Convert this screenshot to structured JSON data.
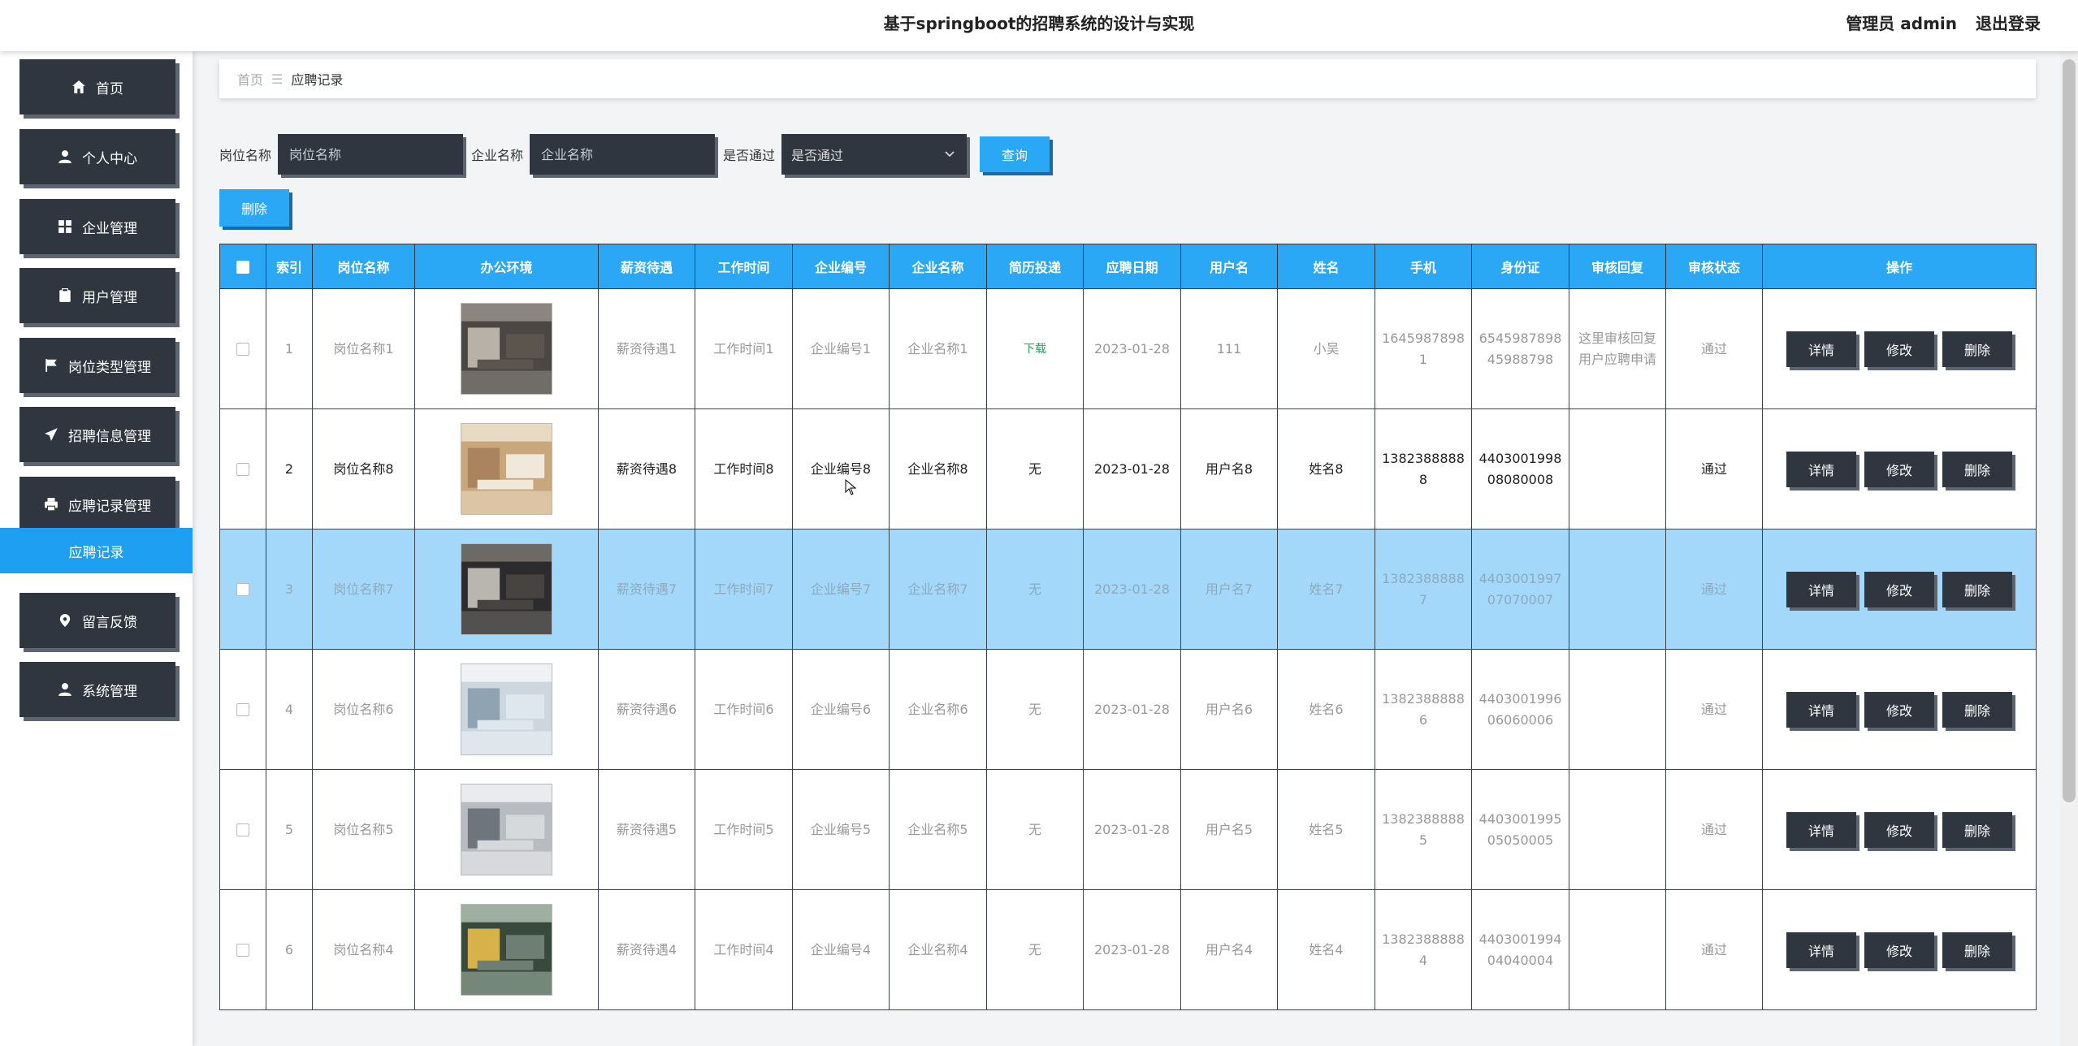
{
  "header": {
    "title": "基于springboot的招聘系统的设计与实现",
    "user": "管理员 admin",
    "logout": "退出登录"
  },
  "sidebar": {
    "items": [
      {
        "label": "首页",
        "icon": "home-icon"
      },
      {
        "label": "个人中心",
        "icon": "user-icon"
      },
      {
        "label": "企业管理",
        "icon": "grid-icon"
      },
      {
        "label": "用户管理",
        "icon": "clipboard-icon"
      },
      {
        "label": "岗位类型管理",
        "icon": "flag-icon"
      },
      {
        "label": "招聘信息管理",
        "icon": "send-icon"
      },
      {
        "label": "应聘记录管理",
        "icon": "print-icon"
      },
      {
        "label": "留言反馈",
        "icon": "map-pin-icon"
      },
      {
        "label": "系统管理",
        "icon": "user-icon"
      }
    ],
    "active_sub": "应聘记录"
  },
  "breadcrumb": {
    "home": "首页",
    "sep": "☰",
    "current": "应聘记录"
  },
  "filters": {
    "job_label": "岗位名称",
    "job_placeholder": "岗位名称",
    "company_label": "企业名称",
    "company_placeholder": "企业名称",
    "pass_label": "是否通过",
    "pass_placeholder": "是否通过",
    "query": "查询"
  },
  "bulk_delete": "删除",
  "table": {
    "headers": [
      "索引",
      "岗位名称",
      "办公环境",
      "薪资待遇",
      "工作时间",
      "企业编号",
      "企业名称",
      "简历投递",
      "应聘日期",
      "用户名",
      "姓名",
      "手机",
      "身份证",
      "审核回复",
      "审核状态",
      "操作"
    ],
    "actions": {
      "detail": "详情",
      "edit": "修改",
      "delete": "删除"
    },
    "rows": [
      {
        "index": "1",
        "job": "岗位名称1",
        "salary": "薪资待遇1",
        "time": "工作时间1",
        "company_no": "企业编号1",
        "company": "企业名称1",
        "resume": "下载",
        "date": "2023-01-28",
        "username": "111",
        "name": "小吴",
        "phone_1": "1645987898",
        "phone_2": "1",
        "id_1": "6545987898",
        "id_2": "45988798",
        "reply_1": "这里审核回复",
        "reply_2": "用户应聘申请",
        "status": "通过"
      },
      {
        "index": "2",
        "job": "岗位名称8",
        "salary": "薪资待遇8",
        "time": "工作时间8",
        "company_no": "企业编号8",
        "company": "企业名称8",
        "resume": "无",
        "date": "2023-01-28",
        "username": "用户名8",
        "name": "姓名8",
        "phone_1": "1382388888",
        "phone_2": "8",
        "id_1": "4403001998",
        "id_2": "08080008",
        "reply_1": "",
        "reply_2": "",
        "status": "通过"
      },
      {
        "index": "3",
        "job": "岗位名称7",
        "salary": "薪资待遇7",
        "time": "工作时间7",
        "company_no": "企业编号7",
        "company": "企业名称7",
        "resume": "无",
        "date": "2023-01-28",
        "username": "用户名7",
        "name": "姓名7",
        "phone_1": "1382388888",
        "phone_2": "7",
        "id_1": "4403001997",
        "id_2": "07070007",
        "reply_1": "",
        "reply_2": "",
        "status": "通过"
      },
      {
        "index": "4",
        "job": "岗位名称6",
        "salary": "薪资待遇6",
        "time": "工作时间6",
        "company_no": "企业编号6",
        "company": "企业名称6",
        "resume": "无",
        "date": "2023-01-28",
        "username": "用户名6",
        "name": "姓名6",
        "phone_1": "1382388888",
        "phone_2": "6",
        "id_1": "4403001996",
        "id_2": "06060006",
        "reply_1": "",
        "reply_2": "",
        "status": "通过"
      },
      {
        "index": "5",
        "job": "岗位名称5",
        "salary": "薪资待遇5",
        "time": "工作时间5",
        "company_no": "企业编号5",
        "company": "企业名称5",
        "resume": "无",
        "date": "2023-01-28",
        "username": "用户名5",
        "name": "姓名5",
        "phone_1": "1382388888",
        "phone_2": "5",
        "id_1": "4403001995",
        "id_2": "05050005",
        "reply_1": "",
        "reply_2": "",
        "status": "通过"
      },
      {
        "index": "6",
        "job": "岗位名称4",
        "salary": "薪资待遇4",
        "time": "工作时间4",
        "company_no": "企业编号4",
        "company": "企业名称4",
        "resume": "无",
        "date": "2023-01-28",
        "username": "用户名4",
        "name": "姓名4",
        "phone_1": "1382388888",
        "phone_2": "4",
        "id_1": "4403001994",
        "id_2": "04040004",
        "reply_1": "",
        "reply_2": "",
        "status": "通过"
      }
    ]
  }
}
